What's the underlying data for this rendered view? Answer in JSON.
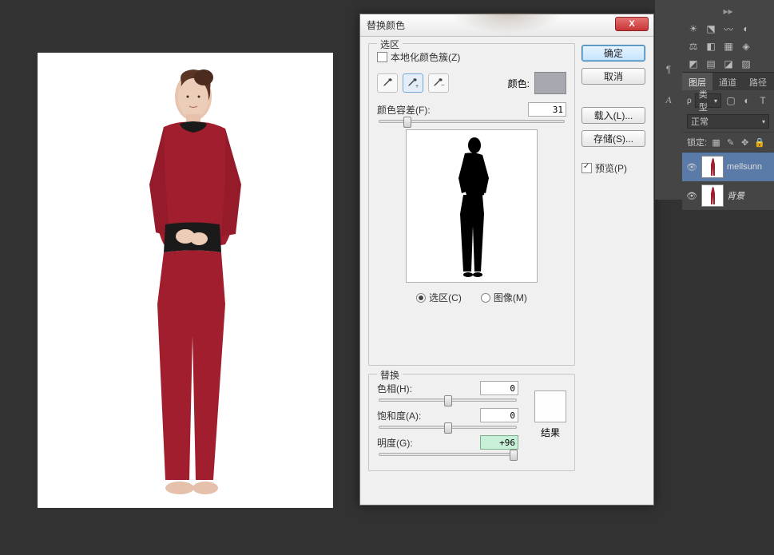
{
  "dialog": {
    "title": "替换颜色",
    "close_label": "X",
    "selection": {
      "legend": "选区",
      "localize_label": "本地化颜色簇(Z)",
      "localize_checked": false,
      "color_label": "颜色:",
      "fuzziness_label": "颜色容差(F):",
      "fuzziness_value": "31",
      "radio_selection": "选区(C)",
      "radio_image": "图像(M)"
    },
    "replace": {
      "legend": "替换",
      "hue_label": "色相(H):",
      "hue_value": "0",
      "saturation_label": "饱和度(A):",
      "saturation_value": "0",
      "lightness_label": "明度(G):",
      "lightness_value": "+96",
      "result_label": "结果"
    },
    "buttons": {
      "ok": "确定",
      "cancel": "取消",
      "load": "载入(L)...",
      "save": "存储(S)...",
      "preview": "预览(P)"
    }
  },
  "panels": {
    "layers_tab": "图层",
    "channels_tab": "通道",
    "paths_tab": "路径",
    "type_label": "类型",
    "blend_mode": "正常",
    "lock_label": "锁定:",
    "layer1_name": "mellsunn",
    "layer2_name": "背景"
  },
  "side_tools": [
    "¶",
    "A"
  ],
  "chart_data": null
}
